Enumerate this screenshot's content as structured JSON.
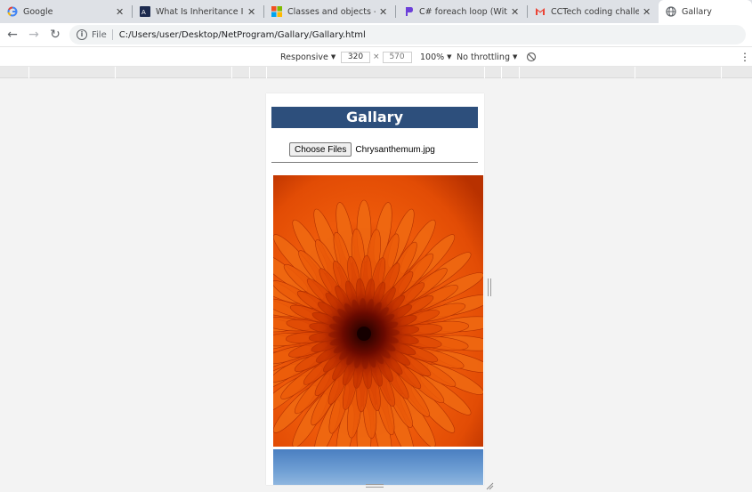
{
  "tabs": [
    {
      "title": "Google",
      "icon": "google-icon"
    },
    {
      "title": "What Is Inheritance In C#",
      "icon": "csharpcorner-icon"
    },
    {
      "title": "Classes and objects - Intr",
      "icon": "microsoft-icon"
    },
    {
      "title": "C# foreach loop (With Ex",
      "icon": "programiz-icon"
    },
    {
      "title": "CCTech coding challenge",
      "icon": "gmail-icon"
    },
    {
      "title": "Gallary",
      "icon": "globe-icon"
    }
  ],
  "address": {
    "scheme_label": "File",
    "url": "C:/Users/user/Desktop/NetProgram/Gallary/Gallary.html"
  },
  "device_toolbar": {
    "mode": "Responsive",
    "width": "320",
    "times": "×",
    "height": "570",
    "zoom": "100%",
    "throttling": "No throttling"
  },
  "page": {
    "title": "Gallary",
    "choose_button": "Choose Files",
    "file_name": "Chrysanthemum.jpg"
  },
  "colors": {
    "banner": "#2d4f7c",
    "tabstrip": "#dee1e6"
  }
}
